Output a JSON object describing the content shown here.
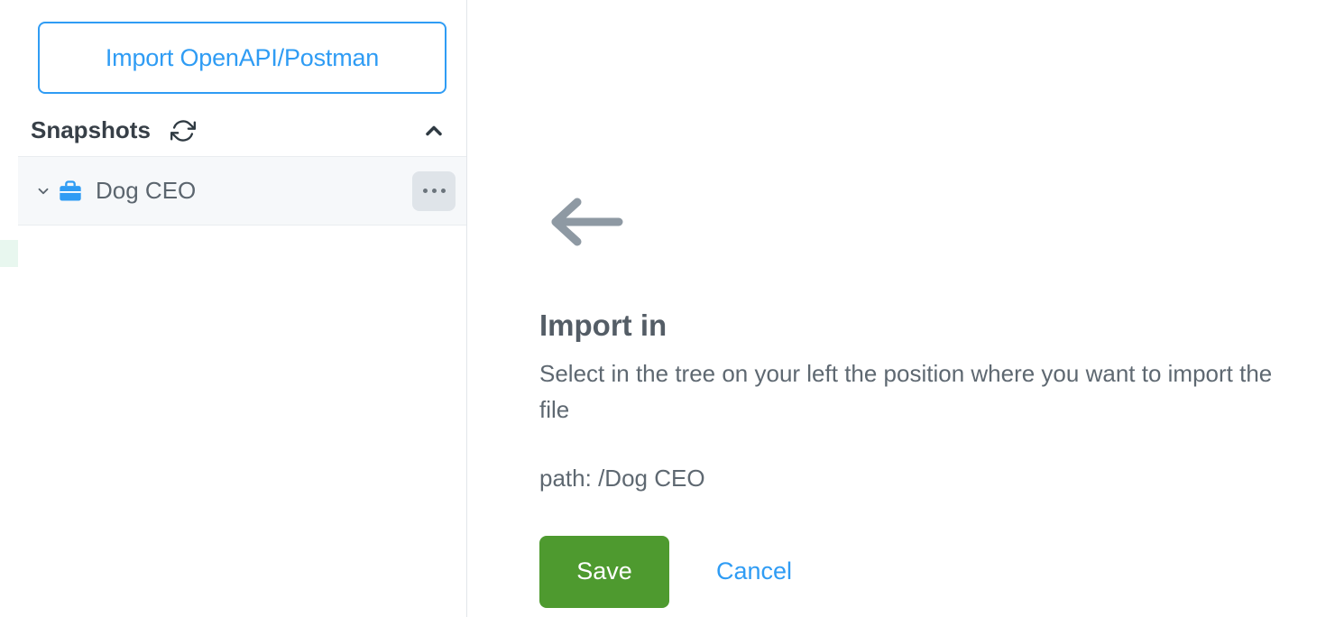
{
  "sidebar": {
    "import_button_label": "Import OpenAPI/Postman",
    "section_title": "Snapshots",
    "items": [
      {
        "label": "Dog CEO"
      }
    ]
  },
  "main": {
    "title": "Import in",
    "description": "Select in the tree on your left the position where you want to import the file",
    "path_prefix": "path: ",
    "path_value": "/Dog CEO",
    "save_label": "Save",
    "cancel_label": "Cancel"
  }
}
